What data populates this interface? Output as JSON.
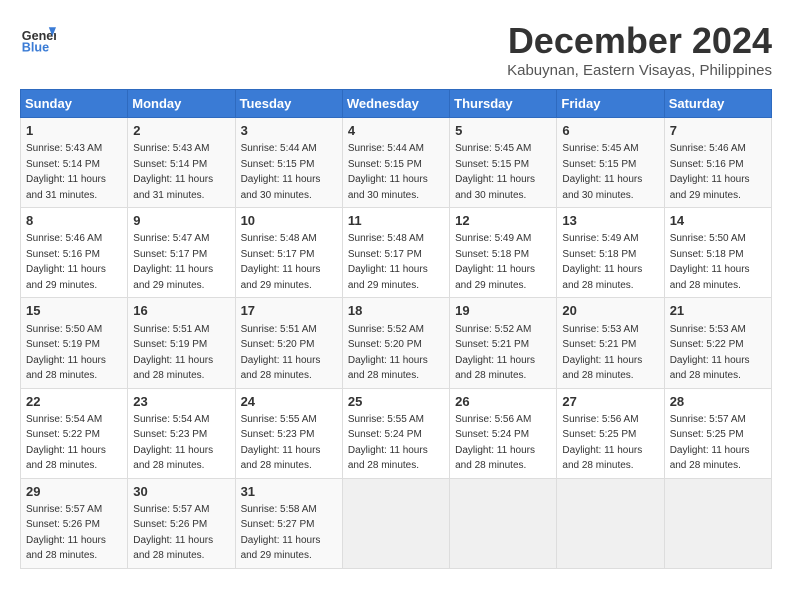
{
  "header": {
    "logo_line1": "General",
    "logo_line2": "Blue",
    "month": "December 2024",
    "location": "Kabuynan, Eastern Visayas, Philippines"
  },
  "weekdays": [
    "Sunday",
    "Monday",
    "Tuesday",
    "Wednesday",
    "Thursday",
    "Friday",
    "Saturday"
  ],
  "weeks": [
    [
      {
        "day": "1",
        "sunrise": "5:43 AM",
        "sunset": "5:14 PM",
        "daylight": "11 hours and 31 minutes."
      },
      {
        "day": "2",
        "sunrise": "5:43 AM",
        "sunset": "5:14 PM",
        "daylight": "11 hours and 31 minutes."
      },
      {
        "day": "3",
        "sunrise": "5:44 AM",
        "sunset": "5:15 PM",
        "daylight": "11 hours and 30 minutes."
      },
      {
        "day": "4",
        "sunrise": "5:44 AM",
        "sunset": "5:15 PM",
        "daylight": "11 hours and 30 minutes."
      },
      {
        "day": "5",
        "sunrise": "5:45 AM",
        "sunset": "5:15 PM",
        "daylight": "11 hours and 30 minutes."
      },
      {
        "day": "6",
        "sunrise": "5:45 AM",
        "sunset": "5:15 PM",
        "daylight": "11 hours and 30 minutes."
      },
      {
        "day": "7",
        "sunrise": "5:46 AM",
        "sunset": "5:16 PM",
        "daylight": "11 hours and 29 minutes."
      }
    ],
    [
      {
        "day": "8",
        "sunrise": "5:46 AM",
        "sunset": "5:16 PM",
        "daylight": "11 hours and 29 minutes."
      },
      {
        "day": "9",
        "sunrise": "5:47 AM",
        "sunset": "5:17 PM",
        "daylight": "11 hours and 29 minutes."
      },
      {
        "day": "10",
        "sunrise": "5:48 AM",
        "sunset": "5:17 PM",
        "daylight": "11 hours and 29 minutes."
      },
      {
        "day": "11",
        "sunrise": "5:48 AM",
        "sunset": "5:17 PM",
        "daylight": "11 hours and 29 minutes."
      },
      {
        "day": "12",
        "sunrise": "5:49 AM",
        "sunset": "5:18 PM",
        "daylight": "11 hours and 29 minutes."
      },
      {
        "day": "13",
        "sunrise": "5:49 AM",
        "sunset": "5:18 PM",
        "daylight": "11 hours and 28 minutes."
      },
      {
        "day": "14",
        "sunrise": "5:50 AM",
        "sunset": "5:18 PM",
        "daylight": "11 hours and 28 minutes."
      }
    ],
    [
      {
        "day": "15",
        "sunrise": "5:50 AM",
        "sunset": "5:19 PM",
        "daylight": "11 hours and 28 minutes."
      },
      {
        "day": "16",
        "sunrise": "5:51 AM",
        "sunset": "5:19 PM",
        "daylight": "11 hours and 28 minutes."
      },
      {
        "day": "17",
        "sunrise": "5:51 AM",
        "sunset": "5:20 PM",
        "daylight": "11 hours and 28 minutes."
      },
      {
        "day": "18",
        "sunrise": "5:52 AM",
        "sunset": "5:20 PM",
        "daylight": "11 hours and 28 minutes."
      },
      {
        "day": "19",
        "sunrise": "5:52 AM",
        "sunset": "5:21 PM",
        "daylight": "11 hours and 28 minutes."
      },
      {
        "day": "20",
        "sunrise": "5:53 AM",
        "sunset": "5:21 PM",
        "daylight": "11 hours and 28 minutes."
      },
      {
        "day": "21",
        "sunrise": "5:53 AM",
        "sunset": "5:22 PM",
        "daylight": "11 hours and 28 minutes."
      }
    ],
    [
      {
        "day": "22",
        "sunrise": "5:54 AM",
        "sunset": "5:22 PM",
        "daylight": "11 hours and 28 minutes."
      },
      {
        "day": "23",
        "sunrise": "5:54 AM",
        "sunset": "5:23 PM",
        "daylight": "11 hours and 28 minutes."
      },
      {
        "day": "24",
        "sunrise": "5:55 AM",
        "sunset": "5:23 PM",
        "daylight": "11 hours and 28 minutes."
      },
      {
        "day": "25",
        "sunrise": "5:55 AM",
        "sunset": "5:24 PM",
        "daylight": "11 hours and 28 minutes."
      },
      {
        "day": "26",
        "sunrise": "5:56 AM",
        "sunset": "5:24 PM",
        "daylight": "11 hours and 28 minutes."
      },
      {
        "day": "27",
        "sunrise": "5:56 AM",
        "sunset": "5:25 PM",
        "daylight": "11 hours and 28 minutes."
      },
      {
        "day": "28",
        "sunrise": "5:57 AM",
        "sunset": "5:25 PM",
        "daylight": "11 hours and 28 minutes."
      }
    ],
    [
      {
        "day": "29",
        "sunrise": "5:57 AM",
        "sunset": "5:26 PM",
        "daylight": "11 hours and 28 minutes."
      },
      {
        "day": "30",
        "sunrise": "5:57 AM",
        "sunset": "5:26 PM",
        "daylight": "11 hours and 28 minutes."
      },
      {
        "day": "31",
        "sunrise": "5:58 AM",
        "sunset": "5:27 PM",
        "daylight": "11 hours and 29 minutes."
      },
      null,
      null,
      null,
      null
    ]
  ]
}
